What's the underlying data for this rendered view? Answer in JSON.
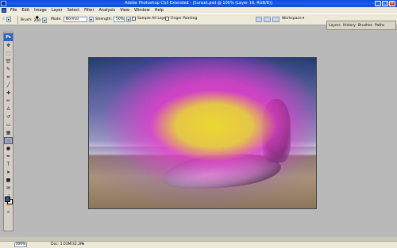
{
  "window": {
    "title": "Adobe Photoshop CS3 Extended - [Sunset.psd @ 100% (Layer 16, RGB/8)]",
    "controls": [
      "_",
      "□",
      "×"
    ]
  },
  "menu": {
    "items": [
      "File",
      "Edit",
      "Image",
      "Layer",
      "Select",
      "Filter",
      "Analysis",
      "View",
      "Window",
      "Help"
    ]
  },
  "options": {
    "brush_label": "Brush:",
    "brush_size": "200",
    "mode_label": "Mode:",
    "mode_value": "Normal",
    "strength_label": "Strength:",
    "strength_value": "50%",
    "sample_all_layers": "Sample All Layers",
    "finger_painting": "Finger Painting",
    "workspace": "Workspace ▾"
  },
  "panels": {
    "tabs": [
      "Layers",
      "History",
      "Brushes",
      "Paths"
    ]
  },
  "toolbox": {
    "logo": "Ps",
    "tools": [
      "move",
      "marquee",
      "lasso",
      "quick-select",
      "crop",
      "slice",
      "healing",
      "brush",
      "stamp",
      "history-brush",
      "eraser",
      "gradient",
      "smudge",
      "dodge",
      "pen",
      "type",
      "path-select",
      "shape",
      "notes",
      "eyedropper",
      "hand",
      "zoom"
    ],
    "active_tool": "smudge",
    "foreground_color": "#2f5690",
    "background_color": "#ffffff"
  },
  "canvas": {
    "description_visible": false
  },
  "status": {
    "zoom": "100%",
    "doc": "Doc: 1.03M/32.2M"
  }
}
